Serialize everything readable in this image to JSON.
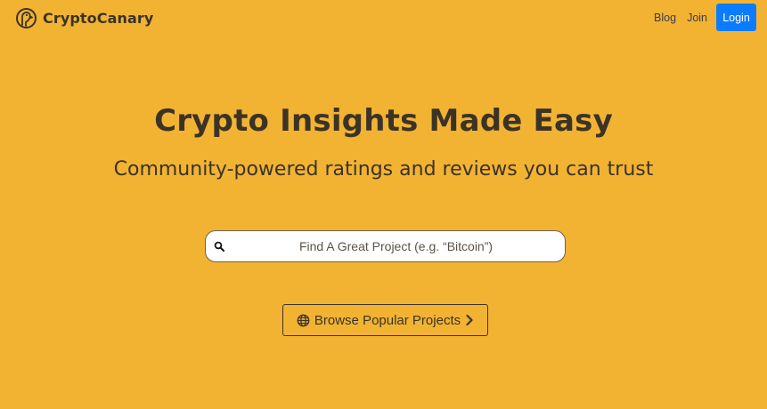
{
  "brand": {
    "name": "CryptoCanary",
    "logo_icon": "canary-logo-icon"
  },
  "nav": {
    "blog": "Blog",
    "join": "Join",
    "login": "Login"
  },
  "hero": {
    "title": "Crypto Insights Made Easy",
    "subtitle": "Community-powered ratings and reviews you can trust"
  },
  "search": {
    "placeholder": "Find A Great Project (e.g. “Bitcoin”)",
    "value": "",
    "icon": "search-icon"
  },
  "browse": {
    "label": "Browse Popular Projects",
    "left_icon": "globe-icon",
    "right_icon": "chevron-right-icon"
  },
  "colors": {
    "background": "#f2b333",
    "text": "#3b3326",
    "login_button": "#0b7cff",
    "login_text": "#ffffff"
  }
}
